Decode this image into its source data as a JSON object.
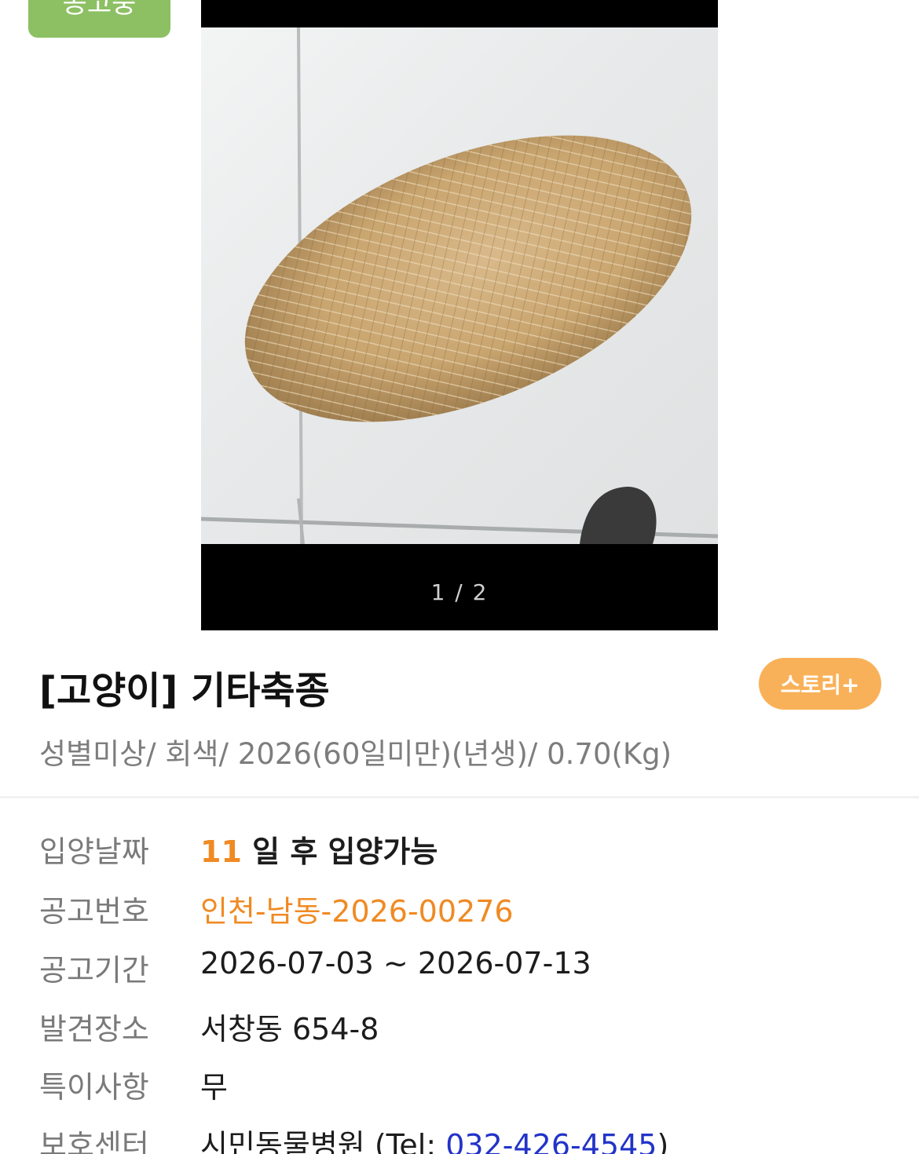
{
  "status_badge": "공고중",
  "photo_viewer": {
    "counter": "1 / 2"
  },
  "animal": {
    "title": "[고양이] 기타축종",
    "story_button": "스토리+",
    "summary": "성별미상/ 회색/ 2026(60일미만)(년생)/ 0.70(Kg)"
  },
  "info": {
    "adoption_date": {
      "label": "입양날짜",
      "days": "11",
      "suffix": "일 후 입양가능"
    },
    "notice_number": {
      "label": "공고번호",
      "value": "인천-남동-2026-00276"
    },
    "notice_period": {
      "label": "공고기간",
      "value": "2026-07-03 ~ 2026-07-13"
    },
    "found_place": {
      "label": "발견장소",
      "value": "서창동 654-8"
    },
    "special_notes": {
      "label": "특이사항",
      "value": "무"
    },
    "shelter": {
      "label": "보호센터",
      "name": "시민동물병원 (Tel: ",
      "phone": "032-426-4545",
      "close": ")"
    }
  },
  "colors": {
    "badge": "#8cc063",
    "story_button": "#f9b159",
    "accent": "#f08a23",
    "link": "#2233c8"
  }
}
